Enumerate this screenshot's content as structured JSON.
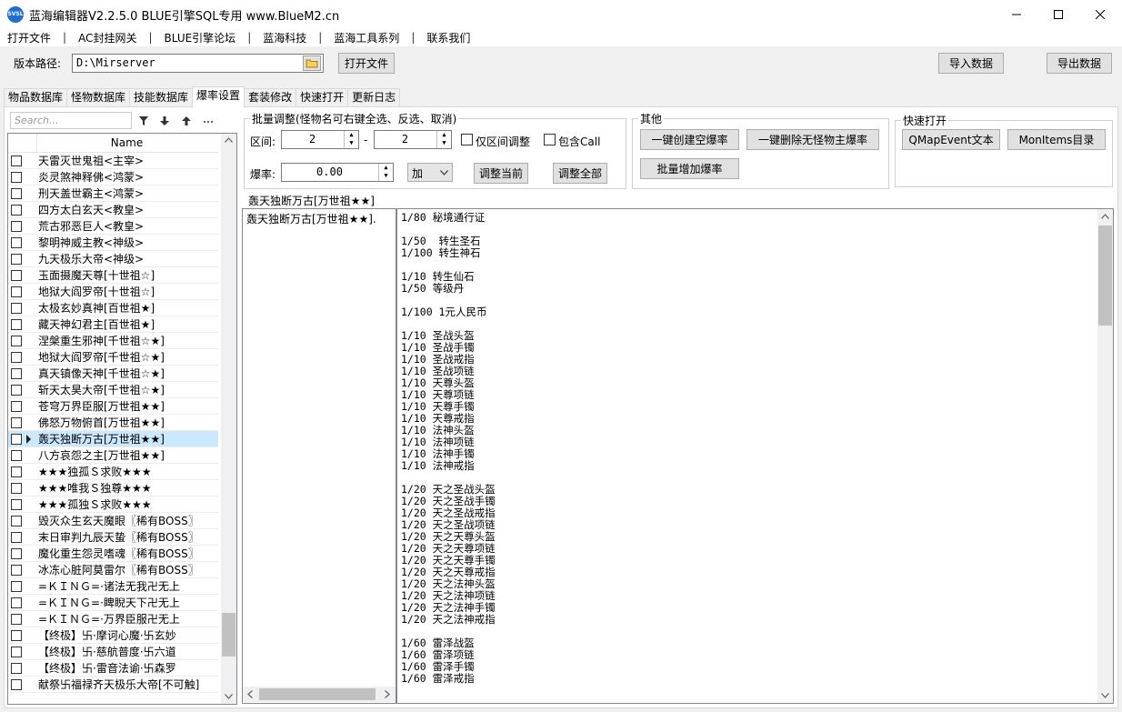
{
  "app": {
    "icon_text": "SVSL",
    "title": "蓝海编辑器V2.2.5.0  BLUE引擎SQL专用   www.BlueM2.cn"
  },
  "menu": [
    "打开文件",
    "AC封挂网关",
    "BLUE引擎论坛",
    "蓝海科技",
    "蓝海工具系列",
    "联系我们"
  ],
  "path": {
    "label": "版本路径:",
    "value": "D:\\Mirserver",
    "open_button": "打开文件"
  },
  "actions": {
    "import": "导入数据",
    "export": "导出数据"
  },
  "tabs": [
    "物品数据库",
    "怪物数据库",
    "技能数据库",
    "爆率设置",
    "套装修改",
    "快速打开",
    "更新日志"
  ],
  "active_tab": "爆率设置",
  "search": {
    "placeholder": "Search..."
  },
  "grid": {
    "column": "Name",
    "rows": [
      "天雷灭世鬼祖<主宰>",
      "炎灵煞神释佛<鸿蒙>",
      "刑天盖世霸主<鸿蒙>",
      "四方太白玄天<教皇>",
      "荒古邪恶巨人<教皇>",
      "黎明神威主教<神级>",
      "九天极乐大帝<神级>",
      "玉面摄魔天尊[十世祖☆]",
      "地狱大阎罗帝[十世祖☆]",
      "太极玄妙真神[百世祖★]",
      "藏天神幻君主[百世祖★]",
      "涅槃重生邪神[千世祖☆★]",
      "地狱大阎罗帝[千世祖☆★]",
      "真天镇像天神[千世祖☆★]",
      "斩天太昊大帝[千世祖☆★]",
      "苍穹万界臣服[万世祖★★]",
      "佛怒万物俯首[万世祖★★]",
      "轰天独断万古[万世祖★★]",
      "八方哀怨之主[万世祖★★]",
      "★★★独孤Ｓ求败★★★",
      "★★★唯我Ｓ独尊★★★",
      "★★★孤独Ｓ求败★★★",
      "毁灭众生玄天魔眼〖稀有BOSS〗",
      "末日审判九辰天蛰〖稀有BOSS〗",
      "魔化重生怨灵嗜魂〖稀有BOSS〗",
      "冰冻心脏阿莫雷尔〖稀有BOSS〗",
      "=ＫＩＮＧ=·诸法无我卍无上",
      "=ＫＩＮＧ=·睥睨天下卍无上",
      "=ＫＩＮＧ=·万界臣服卍无上",
      "【终极】卐·摩诃心魔·卐玄妙",
      "【终极】卐·慈航普度·卐六道",
      "【终极】卐·雷音法谕·卐森罗",
      "献祭卐福禄齐天极乐大帝[不可触]"
    ],
    "selected_index": 17
  },
  "batch": {
    "group_title": "批量调整(怪物名可右键全选、反选、取消)",
    "range_label": "区间:",
    "range_from": "2",
    "range_sep": "-",
    "range_to": "2",
    "only_range_label": "仅区间调整",
    "include_call_label": "包含Call",
    "rate_label": "爆率:",
    "rate_value": "0.00",
    "op_value": "加",
    "adjust_current": "调整当前",
    "adjust_all": "调整全部"
  },
  "other": {
    "group_title": "其他",
    "create_empty": "一键创建空爆率",
    "delete_orphan": "一键删除无怪物主爆率",
    "batch_add": "批量增加爆率"
  },
  "quick": {
    "group_title": "快速打开",
    "qmap": "QMapEvent文本",
    "monitems": "MonItems目录"
  },
  "detail": {
    "title": "轰天独断万古[万世祖★★]",
    "monster_entry": "轰天独断万古[万世祖★★].",
    "drop_lines": [
      "1/80 秘境通行证",
      "",
      "1/50  转生圣石",
      "1/100 转生神石",
      "",
      "1/10 转生仙石",
      "1/50 等级丹",
      "",
      "1/100 1元人民币",
      "",
      "1/10 圣战头盔",
      "1/10 圣战手镯",
      "1/10 圣战戒指",
      "1/10 圣战项链",
      "1/10 天尊头盔",
      "1/10 天尊项链",
      "1/10 天尊手镯",
      "1/10 天尊戒指",
      "1/10 法神头盔",
      "1/10 法神项链",
      "1/10 法神手镯",
      "1/10 法神戒指",
      "",
      "1/20 天之圣战头盔",
      "1/20 天之圣战手镯",
      "1/20 天之圣战戒指",
      "1/20 天之圣战项链",
      "1/20 天之天尊头盔",
      "1/20 天之天尊项链",
      "1/20 天之天尊手镯",
      "1/20 天之天尊戒指",
      "1/20 天之法神头盔",
      "1/20 天之法神项链",
      "1/20 天之法神手镯",
      "1/20 天之法神戒指",
      "",
      "1/60 雷泽战盔",
      "1/60 雷泽项链",
      "1/60 雷泽手镯",
      "1/60 雷泽戒指"
    ]
  }
}
